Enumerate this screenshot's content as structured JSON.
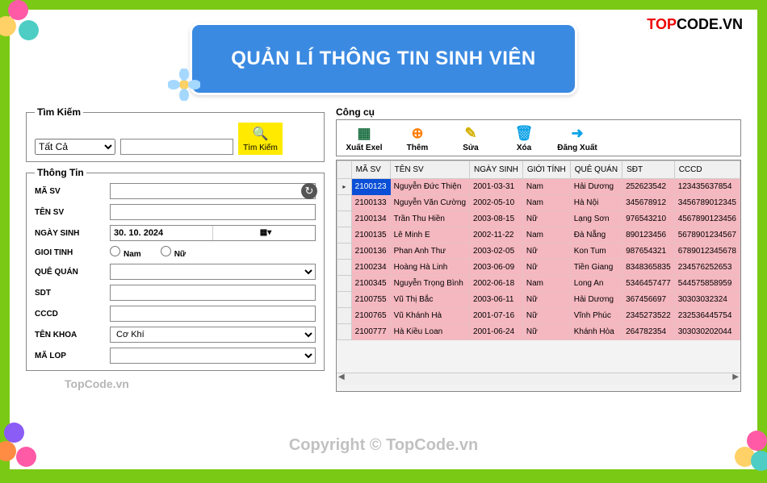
{
  "brand": {
    "part1": "TOP",
    "part2": "CODE.VN"
  },
  "title": "QUẢN LÍ THÔNG TIN SINH VIÊN",
  "search": {
    "legend": "Tìm Kiếm",
    "filter_selected": "Tất Cả",
    "input_value": "",
    "button_label": "Tìm Kiếm"
  },
  "info": {
    "legend": "Thông Tin",
    "fields": {
      "masv_label": "MÃ SV",
      "masv_value": "",
      "tensv_label": "TÊN SV",
      "tensv_value": "",
      "ngaysinh_label": "NGÀY SINH",
      "ngaysinh_value": "30. 10. 2024",
      "gioitinh_label": "GIOI TINH",
      "radio_nam": "Nam",
      "radio_nu": "Nữ",
      "quequan_label": "QUÊ QUÁN",
      "quequan_value": "",
      "sdt_label": "SDT",
      "sdt_value": "",
      "cccd_label": "CCCD",
      "cccd_value": "",
      "tenkhoa_label": "TÊN KHOA",
      "tenkhoa_value": "Cơ Khí",
      "malop_label": "MÃ LOP",
      "malop_value": ""
    }
  },
  "tools": {
    "legend": "Công cụ",
    "buttons": {
      "export": "Xuất Exel",
      "add": "Thêm",
      "edit": "Sửa",
      "delete": "Xóa",
      "logout": "Đăng Xuất"
    }
  },
  "table": {
    "headers": [
      "MÃ SV",
      "TÊN SV",
      "NGÀY SINH",
      "GIỚI TÍNH",
      "QUÊ QUÁN",
      "SĐT",
      "CCCD"
    ],
    "rows": [
      [
        "2100123",
        "Nguyễn Đức Thiện",
        "2001-03-31",
        "Nam",
        "Hải Dương",
        "252623542",
        "123435637854"
      ],
      [
        "2100133",
        "Nguyễn Văn Cường",
        "2002-05-10",
        "Nam",
        "Hà Nội",
        "345678912",
        "3456789012345"
      ],
      [
        "2100134",
        "Trần Thu Hiền",
        "2003-08-15",
        "Nữ",
        "Lạng Sơn",
        "976543210",
        "4567890123456"
      ],
      [
        "2100135",
        "Lê Minh E",
        "2002-11-22",
        "Nam",
        "Đà Nẵng",
        "890123456",
        "5678901234567"
      ],
      [
        "2100136",
        "Phan Anh Thư",
        "2003-02-05",
        "Nữ",
        "Kon Tum",
        "987654321",
        "6789012345678"
      ],
      [
        "2100234",
        "Hoàng Hà Linh",
        "2003-06-09",
        "Nữ",
        "Tiền Giang",
        "8348365835",
        "234576252653"
      ],
      [
        "2100345",
        "Nguyễn Trọng Bình",
        "2002-06-18",
        "Nam",
        "Long An",
        "5346457477",
        "544575858959"
      ],
      [
        "2100755",
        "Vũ Thị Bắc",
        "2003-06-11",
        "Nữ",
        "Hải Dương",
        "367456697",
        "30303032324"
      ],
      [
        "2100765",
        "Vũ Khánh Hà",
        "2001-07-16",
        "Nữ",
        "Vĩnh Phúc",
        "2345273522",
        "232536445754"
      ],
      [
        "2100777",
        "Hà Kiều Loan",
        "2001-06-24",
        "Nữ",
        "Khánh Hòa",
        "264782354",
        "303030202044"
      ]
    ],
    "selected_row": 0
  },
  "watermarks": {
    "side": "TopCode.vn",
    "bottom": "Copyright © TopCode.vn"
  }
}
